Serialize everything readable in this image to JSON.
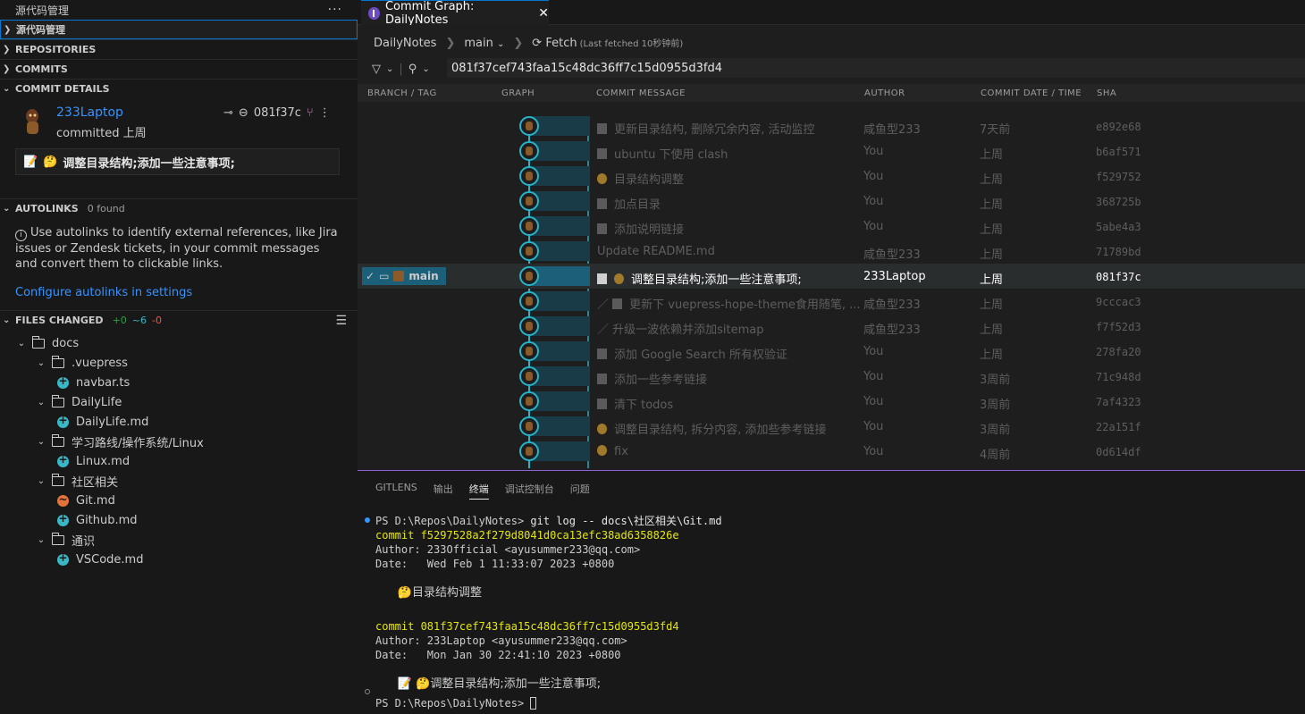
{
  "sidebar": {
    "title": "源代码管理",
    "sections": {
      "scm": "源代码管理",
      "repositories": "REPOSITORIES",
      "commits": "COMMITS",
      "commit_details": "COMMIT DETAILS",
      "autolinks": "AUTOLINKS",
      "autolinks_count": "0 found",
      "files_changed": "FILES CHANGED",
      "files_added": "+0",
      "files_modified": "~6",
      "files_removed": "-0"
    },
    "commit": {
      "author": "233Laptop",
      "committed": "committed 上周",
      "sha": "081f37c",
      "message": "调整目录结构;添加一些注意事项;"
    },
    "autolinks_text": "Use autolinks to identify external references, like Jira issues or Zendesk tickets, in your commit messages and convert them to clickable links.",
    "autolinks_link": "Configure autolinks in settings",
    "files": [
      {
        "type": "folder",
        "name": "docs",
        "depth": 0
      },
      {
        "type": "folder",
        "name": ".vuepress",
        "depth": 1
      },
      {
        "type": "file",
        "name": "navbar.ts",
        "depth": 2,
        "status": "added"
      },
      {
        "type": "folder",
        "name": "DailyLife",
        "depth": 1
      },
      {
        "type": "file",
        "name": "DailyLife.md",
        "depth": 2,
        "status": "added"
      },
      {
        "type": "folder",
        "name": "学习路线/操作系统/Linux",
        "depth": 1
      },
      {
        "type": "file",
        "name": "Linux.md",
        "depth": 2,
        "status": "added"
      },
      {
        "type": "folder",
        "name": "社区相关",
        "depth": 1
      },
      {
        "type": "file",
        "name": "Git.md",
        "depth": 2,
        "status": "modified"
      },
      {
        "type": "file",
        "name": "Github.md",
        "depth": 2,
        "status": "added"
      },
      {
        "type": "folder",
        "name": "通识",
        "depth": 1
      },
      {
        "type": "file",
        "name": "VSCode.md",
        "depth": 2,
        "status": "added"
      }
    ]
  },
  "tab": {
    "title": "Commit Graph: DailyNotes"
  },
  "toolbar": {
    "repo": "DailyNotes",
    "branch": "main",
    "fetch": "Fetch",
    "fetch_note": "(Last fetched 10秒钟前)",
    "search_value": "081f37cef743faa15c48dc36ff7c15d0955d3fd4"
  },
  "graph": {
    "columns": {
      "branch": "BRANCH / TAG",
      "graph": "GRAPH",
      "message": "COMMIT MESSAGE",
      "author": "AUTHOR",
      "date": "COMMIT DATE / TIME",
      "sha": "SHA"
    },
    "branch_label": "main",
    "rows": [
      {
        "msg": "更新目录结构, 删除冗余内容, 活动监控",
        "author": "咸鱼型233",
        "date": "7天前",
        "sha": "e892e68",
        "icon": "doc"
      },
      {
        "msg": "ubuntu 下使用 clash",
        "author": "You",
        "date": "上周",
        "sha": "b6af571",
        "icon": "doc"
      },
      {
        "msg": "目录结构调整",
        "author": "You",
        "date": "上周",
        "sha": "f529752",
        "icon": "emoji"
      },
      {
        "msg": "加点目录",
        "author": "You",
        "date": "上周",
        "sha": "368725b",
        "icon": "doc"
      },
      {
        "msg": "添加说明链接",
        "author": "You",
        "date": "上周",
        "sha": "5abe4a3",
        "icon": "doc"
      },
      {
        "msg": "Update README.md",
        "author": "咸鱼型233",
        "date": "上周",
        "sha": "71789bd",
        "icon": ""
      },
      {
        "msg": "调整目录结构;添加一些注意事项;",
        "author": "233Laptop",
        "date": "上周",
        "sha": "081f37c",
        "icon": "doc-emoji",
        "selected": true
      },
      {
        "msg": "更新下 vuepress-hope-theme食用随笔, ...",
        "author": "咸鱼型233",
        "date": "上周",
        "sha": "9cccac3",
        "icon": "pen-doc"
      },
      {
        "msg": "升级一波依赖并添加sitemap",
        "author": "咸鱼型233",
        "date": "上周",
        "sha": "f7f52d3",
        "icon": "pen"
      },
      {
        "msg": "添加 Google Search 所有权验证",
        "author": "You",
        "date": "上周",
        "sha": "278fa20",
        "icon": "doc"
      },
      {
        "msg": "添加一些参考链接",
        "author": "You",
        "date": "3周前",
        "sha": "71c948d",
        "icon": "doc"
      },
      {
        "msg": "清下 todos",
        "author": "You",
        "date": "3周前",
        "sha": "7af4323",
        "icon": "doc"
      },
      {
        "msg": "调整目录结构, 拆分内容, 添加些参考链接",
        "author": "You",
        "date": "3周前",
        "sha": "22a151f",
        "icon": "emoji"
      },
      {
        "msg": "fix",
        "author": "You",
        "date": "4周前",
        "sha": "0d614df",
        "icon": "emoji"
      }
    ]
  },
  "panel": {
    "tabs": [
      "GITLENS",
      "输出",
      "终端",
      "调试控制台",
      "问题"
    ],
    "active_tab": "终端",
    "terminal": {
      "line1_prompt": "PS D:\\Repos\\DailyNotes> ",
      "line1_cmd": "git log -- docs\\社区相关\\Git.md",
      "commit1": "commit f5297528a2f279d8041d0ca13efc38ad6358826e",
      "author1": "Author: 233Official <ayusummer233@qq.com>",
      "date1": "Date:   Wed Feb 1 11:33:07 2023 +0800",
      "msg1": "目录结构调整",
      "commit2": "commit 081f37cef743faa15c48dc36ff7c15d0955d3fd4",
      "author2": "Author: 233Laptop <ayusummer233@qq.com>",
      "date2": "Date:   Mon Jan 30 22:41:10 2023 +0800",
      "msg2": "调整目录结构;添加一些注意事项;",
      "last_prompt": "PS D:\\Repos\\DailyNotes> "
    }
  },
  "colors": {
    "accent": "#0078d4",
    "graph_line": "#27b4c9",
    "link": "#3794ff"
  }
}
